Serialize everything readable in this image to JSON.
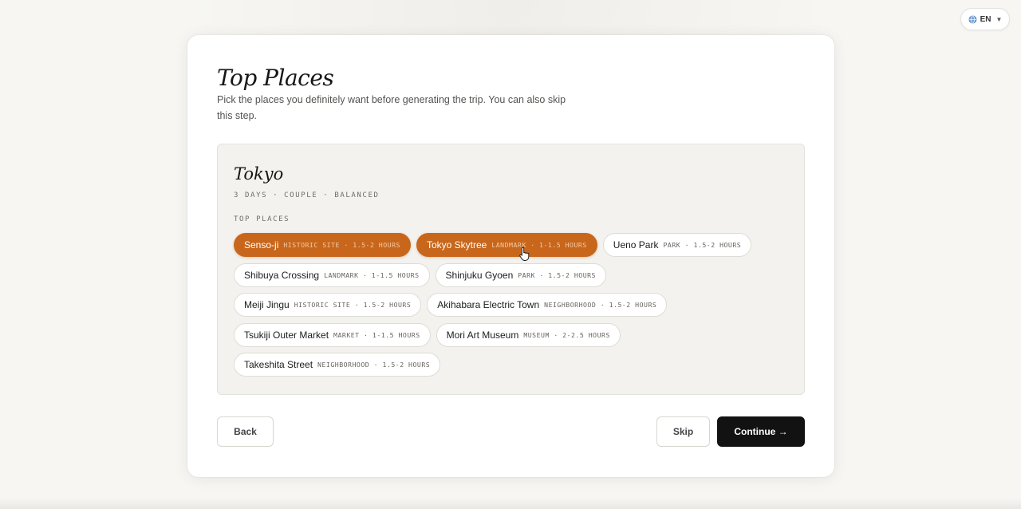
{
  "language": {
    "label": "EN",
    "icon": "globe-icon",
    "dropdown_icon": "caret-down-icon"
  },
  "step": {
    "title": "Top Places",
    "subtitle": "Pick the places you definitely want before generating the trip. You can also skip this step."
  },
  "destination": {
    "city": "Tokyo",
    "meta": "3 DAYS · COUPLE · BALANCED",
    "section_label": "TOP PLACES",
    "places": [
      {
        "name": "Senso-ji",
        "info": "HISTORIC SITE · 1.5-2 HOURS",
        "selected": true
      },
      {
        "name": "Tokyo Skytree",
        "info": "LANDMARK · 1-1.5 HOURS",
        "selected": true
      },
      {
        "name": "Ueno Park",
        "info": "PARK · 1.5-2 HOURS",
        "selected": false
      },
      {
        "name": "Shibuya Crossing",
        "info": "LANDMARK · 1-1.5 HOURS",
        "selected": false
      },
      {
        "name": "Shinjuku Gyoen",
        "info": "PARK · 1.5-2 HOURS",
        "selected": false
      },
      {
        "name": "Meiji Jingu",
        "info": "HISTORIC SITE · 1.5-2 HOURS",
        "selected": false
      },
      {
        "name": "Akihabara Electric Town",
        "info": "NEIGHBORHOOD · 1.5-2 HOURS",
        "selected": false
      },
      {
        "name": "Tsukiji Outer Market",
        "info": "MARKET · 1-1.5 HOURS",
        "selected": false
      },
      {
        "name": "Mori Art Museum",
        "info": "MUSEUM · 2-2.5 HOURS",
        "selected": false
      },
      {
        "name": "Takeshita Street",
        "info": "NEIGHBORHOOD · 1.5-2 HOURS",
        "selected": false
      }
    ]
  },
  "actions": {
    "back_label": "Back",
    "skip_label": "Skip",
    "continue_label": "Continue →"
  },
  "colors": {
    "accent": "#c8671c",
    "primary_button": "#121212",
    "panel_bg": "#f3f2ee"
  }
}
